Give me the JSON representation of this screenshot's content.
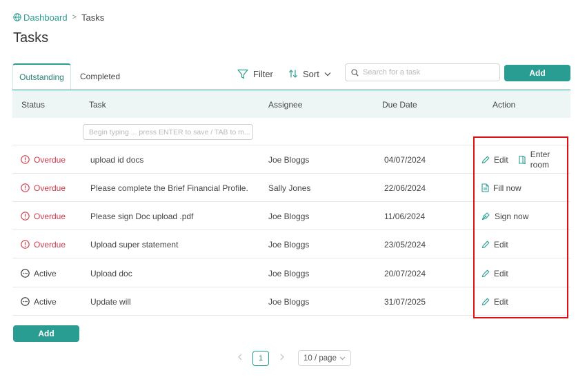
{
  "breadcrumb": {
    "home": "Dashboard",
    "separator": ">",
    "current": "Tasks"
  },
  "page": {
    "title": "Tasks"
  },
  "tabs": [
    {
      "label": "Outstanding",
      "active": true
    },
    {
      "label": "Completed",
      "active": false
    }
  ],
  "toolbar": {
    "filter_label": "Filter",
    "sort_label": "Sort",
    "search_placeholder": "Search for a task",
    "add_label": "Add"
  },
  "table": {
    "columns": [
      "Status",
      "Task",
      "Assignee",
      "Due Date",
      "Action"
    ],
    "new_task_placeholder": "Begin typing ... press ENTER to save / TAB to m...",
    "rows": [
      {
        "status": "Overdue",
        "task": "upload id docs",
        "assignee": "Joe Bloggs",
        "due": "04/07/2024",
        "actions": [
          "Edit",
          "Enter room"
        ]
      },
      {
        "status": "Overdue",
        "task": "Please complete the Brief Financial Profile.",
        "assignee": "Sally Jones",
        "due": "22/06/2024",
        "actions": [
          "Fill now"
        ]
      },
      {
        "status": "Overdue",
        "task": "Please sign Doc upload .pdf",
        "assignee": "Joe Bloggs",
        "due": "11/06/2024",
        "actions": [
          "Sign now"
        ]
      },
      {
        "status": "Overdue",
        "task": "Upload super statement",
        "assignee": "Joe Bloggs",
        "due": "23/05/2024",
        "actions": [
          "Edit"
        ]
      },
      {
        "status": "Active",
        "task": "Upload doc",
        "assignee": "Joe Bloggs",
        "due": "20/07/2024",
        "actions": [
          "Edit"
        ]
      },
      {
        "status": "Active",
        "task": "Update will",
        "assignee": "Joe Bloggs",
        "due": "31/07/2025",
        "actions": [
          "Edit"
        ]
      }
    ]
  },
  "footer": {
    "add_label": "Add"
  },
  "pagination": {
    "current_page": "1",
    "page_size": "10 / page"
  },
  "colors": {
    "accent": "#2a9d92",
    "overdue": "#cc3b4b",
    "highlight": "#e01010"
  },
  "icons": {
    "breadcrumb": "globe-icon",
    "filter": "filter-icon",
    "sort": "sort-icon",
    "search": "search-icon",
    "overdue": "alert-circle-icon",
    "active": "more-circle-icon",
    "edit": "pencil-icon",
    "enter_room": "door-icon",
    "fill_now": "document-icon",
    "sign_now": "pen-nib-icon"
  }
}
